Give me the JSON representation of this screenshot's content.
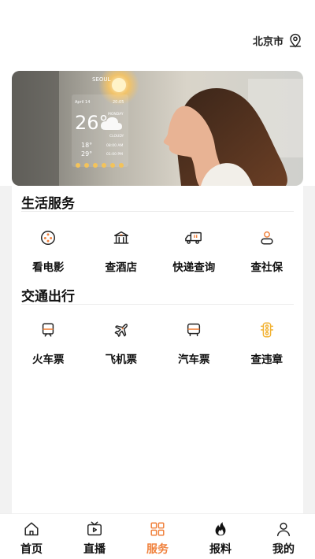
{
  "header": {
    "location": "北京市",
    "location_icon": "location-pin-icon"
  },
  "banner": {
    "weather_widget": {
      "city": "SEOUL",
      "date": "April 14",
      "time": "20:05",
      "temperature": "26°",
      "day": "MONDAY",
      "condition": "CLOUDY",
      "forecast_top": "18°",
      "forecast_bottom": "29°",
      "forecast_time1": "08:00 AM",
      "forecast_time2": "01:00 PM"
    }
  },
  "sections": [
    {
      "title": "生活服务",
      "items": [
        {
          "label": "看电影",
          "icon": "film-reel-icon"
        },
        {
          "label": "查酒店",
          "icon": "hotel-building-icon"
        },
        {
          "label": "快递查询",
          "icon": "delivery-truck-icon"
        },
        {
          "label": "查社保",
          "icon": "person-icon"
        }
      ]
    },
    {
      "title": "交通出行",
      "items": [
        {
          "label": "火车票",
          "icon": "train-icon"
        },
        {
          "label": "飞机票",
          "icon": "airplane-icon"
        },
        {
          "label": "汽车票",
          "icon": "bus-icon"
        },
        {
          "label": "查违章",
          "icon": "traffic-light-icon"
        }
      ]
    }
  ],
  "tabbar": [
    {
      "label": "首页",
      "icon": "home-icon",
      "active": false
    },
    {
      "label": "直播",
      "icon": "live-tv-icon",
      "active": false
    },
    {
      "label": "服务",
      "icon": "grid-services-icon",
      "active": true
    },
    {
      "label": "报料",
      "icon": "flame-icon",
      "active": false
    },
    {
      "label": "我的",
      "icon": "user-icon",
      "active": false
    }
  ],
  "colors": {
    "accent": "#f0813c",
    "traffic_light": "#f2b233",
    "text": "#111111"
  }
}
